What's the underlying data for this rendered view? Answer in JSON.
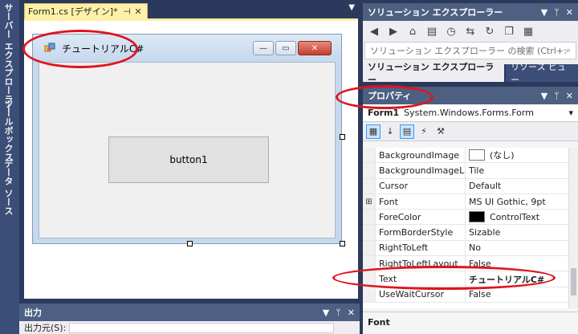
{
  "left_strip": {
    "tabs": [
      "サーバー エクスプローラー",
      "ツールボックス",
      "データ ソース"
    ]
  },
  "document": {
    "tab_label": "Form1.cs [デザイン]*",
    "pin_icon": "pin-icon",
    "close_icon": "close-icon"
  },
  "form": {
    "title": "チュートリアルC#",
    "button_label": "button1",
    "min_glyph": "—",
    "max_glyph": "▭",
    "close_glyph": "✕"
  },
  "output": {
    "title": "出力",
    "source_label": "出力元(S):"
  },
  "solution_explorer": {
    "title": "ソリューション エクスプローラー",
    "search_placeholder": "ソリューション エクスプローラー の検索 (Ctrl+:)",
    "tabs": [
      "ソリューション エクスプローラー",
      "リソース ビュー"
    ]
  },
  "properties": {
    "title": "プロパティ",
    "object_name": "Form1",
    "object_type": "System.Windows.Forms.Form",
    "rows": [
      {
        "name": "BackgroundImage",
        "value": "(なし)",
        "swatch": "#ffffff"
      },
      {
        "name": "BackgroundImageLayout",
        "value": "Tile"
      },
      {
        "name": "Cursor",
        "value": "Default"
      },
      {
        "name": "Font",
        "value": "MS UI Gothic, 9pt",
        "expandable": true
      },
      {
        "name": "ForeColor",
        "value": "ControlText",
        "swatch": "#000000"
      },
      {
        "name": "FormBorderStyle",
        "value": "Sizable"
      },
      {
        "name": "RightToLeft",
        "value": "No"
      },
      {
        "name": "RightToLeftLayout",
        "value": "False"
      },
      {
        "name": "Text",
        "value": "チュートリアルC#",
        "bold": true
      },
      {
        "name": "UseWaitCursor",
        "value": "False"
      }
    ],
    "description_title": "Font"
  },
  "colors": {
    "ide_background": "#2b3a5c",
    "active_tab": "#fff1a8",
    "annotation_red": "#e0141e"
  }
}
